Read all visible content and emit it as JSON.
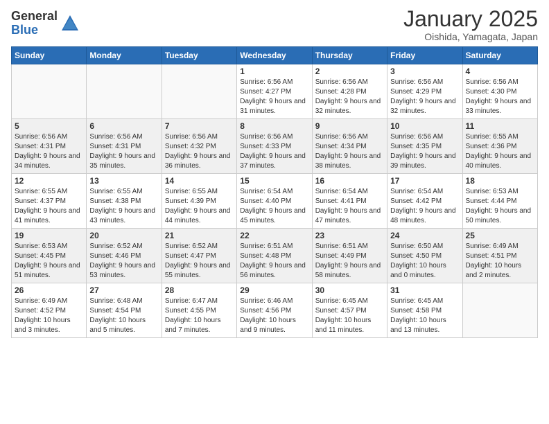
{
  "logo": {
    "general": "General",
    "blue": "Blue"
  },
  "header": {
    "month": "January 2025",
    "location": "Oishida, Yamagata, Japan"
  },
  "weekdays": [
    "Sunday",
    "Monday",
    "Tuesday",
    "Wednesday",
    "Thursday",
    "Friday",
    "Saturday"
  ],
  "weeks": [
    [
      {
        "day": "",
        "info": ""
      },
      {
        "day": "",
        "info": ""
      },
      {
        "day": "",
        "info": ""
      },
      {
        "day": "1",
        "info": "Sunrise: 6:56 AM\nSunset: 4:27 PM\nDaylight: 9 hours and 31 minutes."
      },
      {
        "day": "2",
        "info": "Sunrise: 6:56 AM\nSunset: 4:28 PM\nDaylight: 9 hours and 32 minutes."
      },
      {
        "day": "3",
        "info": "Sunrise: 6:56 AM\nSunset: 4:29 PM\nDaylight: 9 hours and 32 minutes."
      },
      {
        "day": "4",
        "info": "Sunrise: 6:56 AM\nSunset: 4:30 PM\nDaylight: 9 hours and 33 minutes."
      }
    ],
    [
      {
        "day": "5",
        "info": "Sunrise: 6:56 AM\nSunset: 4:31 PM\nDaylight: 9 hours and 34 minutes."
      },
      {
        "day": "6",
        "info": "Sunrise: 6:56 AM\nSunset: 4:31 PM\nDaylight: 9 hours and 35 minutes."
      },
      {
        "day": "7",
        "info": "Sunrise: 6:56 AM\nSunset: 4:32 PM\nDaylight: 9 hours and 36 minutes."
      },
      {
        "day": "8",
        "info": "Sunrise: 6:56 AM\nSunset: 4:33 PM\nDaylight: 9 hours and 37 minutes."
      },
      {
        "day": "9",
        "info": "Sunrise: 6:56 AM\nSunset: 4:34 PM\nDaylight: 9 hours and 38 minutes."
      },
      {
        "day": "10",
        "info": "Sunrise: 6:56 AM\nSunset: 4:35 PM\nDaylight: 9 hours and 39 minutes."
      },
      {
        "day": "11",
        "info": "Sunrise: 6:55 AM\nSunset: 4:36 PM\nDaylight: 9 hours and 40 minutes."
      }
    ],
    [
      {
        "day": "12",
        "info": "Sunrise: 6:55 AM\nSunset: 4:37 PM\nDaylight: 9 hours and 41 minutes."
      },
      {
        "day": "13",
        "info": "Sunrise: 6:55 AM\nSunset: 4:38 PM\nDaylight: 9 hours and 43 minutes."
      },
      {
        "day": "14",
        "info": "Sunrise: 6:55 AM\nSunset: 4:39 PM\nDaylight: 9 hours and 44 minutes."
      },
      {
        "day": "15",
        "info": "Sunrise: 6:54 AM\nSunset: 4:40 PM\nDaylight: 9 hours and 45 minutes."
      },
      {
        "day": "16",
        "info": "Sunrise: 6:54 AM\nSunset: 4:41 PM\nDaylight: 9 hours and 47 minutes."
      },
      {
        "day": "17",
        "info": "Sunrise: 6:54 AM\nSunset: 4:42 PM\nDaylight: 9 hours and 48 minutes."
      },
      {
        "day": "18",
        "info": "Sunrise: 6:53 AM\nSunset: 4:44 PM\nDaylight: 9 hours and 50 minutes."
      }
    ],
    [
      {
        "day": "19",
        "info": "Sunrise: 6:53 AM\nSunset: 4:45 PM\nDaylight: 9 hours and 51 minutes."
      },
      {
        "day": "20",
        "info": "Sunrise: 6:52 AM\nSunset: 4:46 PM\nDaylight: 9 hours and 53 minutes."
      },
      {
        "day": "21",
        "info": "Sunrise: 6:52 AM\nSunset: 4:47 PM\nDaylight: 9 hours and 55 minutes."
      },
      {
        "day": "22",
        "info": "Sunrise: 6:51 AM\nSunset: 4:48 PM\nDaylight: 9 hours and 56 minutes."
      },
      {
        "day": "23",
        "info": "Sunrise: 6:51 AM\nSunset: 4:49 PM\nDaylight: 9 hours and 58 minutes."
      },
      {
        "day": "24",
        "info": "Sunrise: 6:50 AM\nSunset: 4:50 PM\nDaylight: 10 hours and 0 minutes."
      },
      {
        "day": "25",
        "info": "Sunrise: 6:49 AM\nSunset: 4:51 PM\nDaylight: 10 hours and 2 minutes."
      }
    ],
    [
      {
        "day": "26",
        "info": "Sunrise: 6:49 AM\nSunset: 4:52 PM\nDaylight: 10 hours and 3 minutes."
      },
      {
        "day": "27",
        "info": "Sunrise: 6:48 AM\nSunset: 4:54 PM\nDaylight: 10 hours and 5 minutes."
      },
      {
        "day": "28",
        "info": "Sunrise: 6:47 AM\nSunset: 4:55 PM\nDaylight: 10 hours and 7 minutes."
      },
      {
        "day": "29",
        "info": "Sunrise: 6:46 AM\nSunset: 4:56 PM\nDaylight: 10 hours and 9 minutes."
      },
      {
        "day": "30",
        "info": "Sunrise: 6:45 AM\nSunset: 4:57 PM\nDaylight: 10 hours and 11 minutes."
      },
      {
        "day": "31",
        "info": "Sunrise: 6:45 AM\nSunset: 4:58 PM\nDaylight: 10 hours and 13 minutes."
      },
      {
        "day": "",
        "info": ""
      }
    ]
  ]
}
